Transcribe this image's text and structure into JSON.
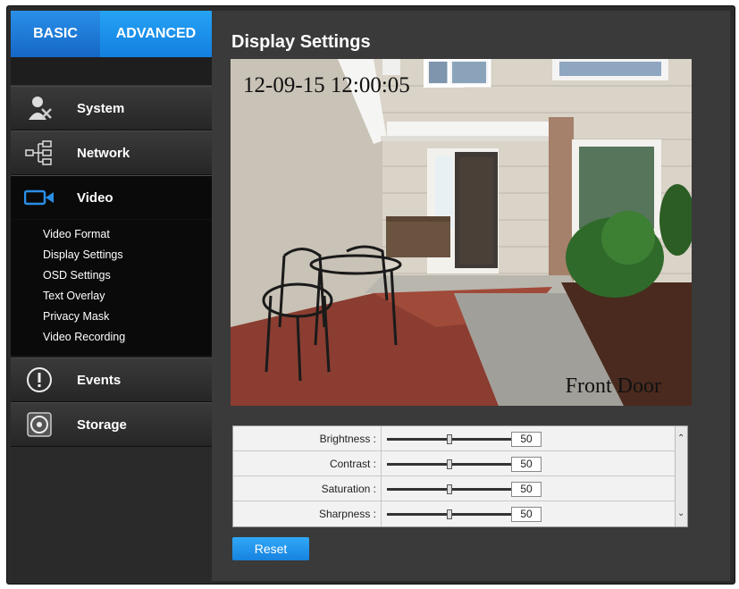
{
  "tabs": {
    "basic": "BASIC",
    "advanced": "ADVANCED"
  },
  "nav": {
    "system": "System",
    "network": "Network",
    "video": "Video",
    "events": "Events",
    "storage": "Storage"
  },
  "video_submenu": [
    "Video Format",
    "Display Settings",
    "OSD Settings",
    "Text Overlay",
    "Privacy Mask",
    "Video Recording"
  ],
  "page": {
    "title": "Display Settings"
  },
  "preview": {
    "timestamp": "12-09-15 12:00:05",
    "camera_name": "Front Door"
  },
  "sliders": [
    {
      "label": "Brightness :",
      "value": "50",
      "level": 50
    },
    {
      "label": "Contrast :",
      "value": "50",
      "level": 50
    },
    {
      "label": "Saturation :",
      "value": "50",
      "level": 50
    },
    {
      "label": "Sharpness :",
      "value": "50",
      "level": 50
    }
  ],
  "reset_label": "Reset",
  "icons": [
    "user-settings-icon",
    "network-icon",
    "video-camera-icon",
    "alert-icon",
    "storage-disc-icon",
    "scroll-up-icon",
    "scroll-down-icon"
  ],
  "colors": {
    "accent": "#1E88E5",
    "sidebar_bg": "#1a1a1a",
    "main_bg": "#3a3a3a"
  }
}
